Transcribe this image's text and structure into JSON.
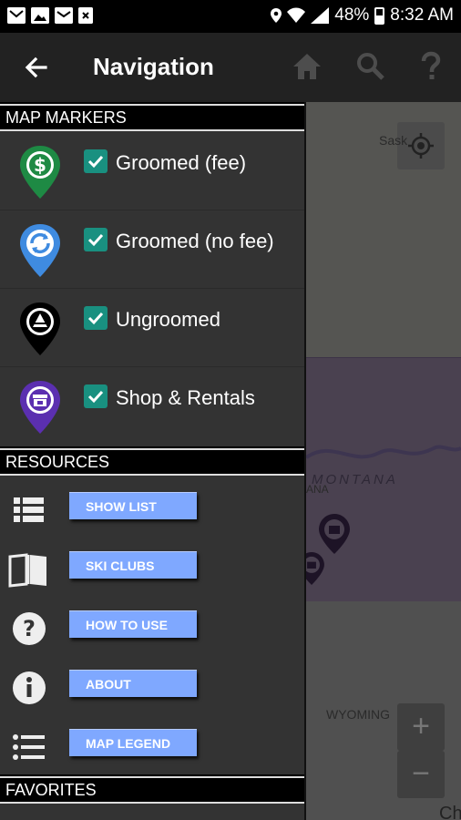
{
  "status_bar": {
    "battery_text": "48%",
    "time": "8:32 AM",
    "left_icons": [
      "gmail-icon",
      "image-icon",
      "mail-icon",
      "close-box-icon"
    ],
    "right_icons": [
      "location-pin-icon",
      "wifi-icon",
      "signal-icon",
      "battery-icon"
    ]
  },
  "app_bar": {
    "title": "Navigation",
    "back_icon": "arrow-left-icon",
    "actions": [
      "home-icon",
      "search-icon",
      "help-icon"
    ]
  },
  "sections": {
    "map_markers": "MAP MARKERS",
    "resources": "RESOURCES",
    "favorites": "FAVORITES"
  },
  "markers": [
    {
      "label": "Groomed (fee)",
      "checked": true,
      "color": "#1e8a44",
      "icon": "dollar-icon"
    },
    {
      "label": "Groomed (no fee)",
      "checked": true,
      "color": "#3f8be0",
      "icon": "refresh-icon"
    },
    {
      "label": "Ungroomed",
      "checked": true,
      "color": "#000000",
      "icon": "triangle-icon"
    },
    {
      "label": "Shop & Rentals",
      "checked": true,
      "color": "#5b2fb0",
      "icon": "shop-icon"
    }
  ],
  "resources": [
    {
      "label": "SHOW LIST",
      "icon": "list-grid-icon"
    },
    {
      "label": "SKI CLUBS",
      "icon": "book-icon"
    },
    {
      "label": "HOW TO USE",
      "icon": "question-circle-icon"
    },
    {
      "label": "ABOUT",
      "icon": "info-circle-icon"
    },
    {
      "label": "MAP LEGEND",
      "icon": "bullet-list-icon"
    }
  ],
  "map": {
    "labels": [
      "Sask",
      "MONTANA",
      "ANA",
      "WYOMING",
      "Ch"
    ],
    "zoom_in": "+",
    "zoom_out": "−"
  },
  "colors": {
    "checkbox": "#199080",
    "resource_button": "#7fa8ff",
    "drawer_bg": "#333333",
    "app_bar_bg": "#222222"
  }
}
